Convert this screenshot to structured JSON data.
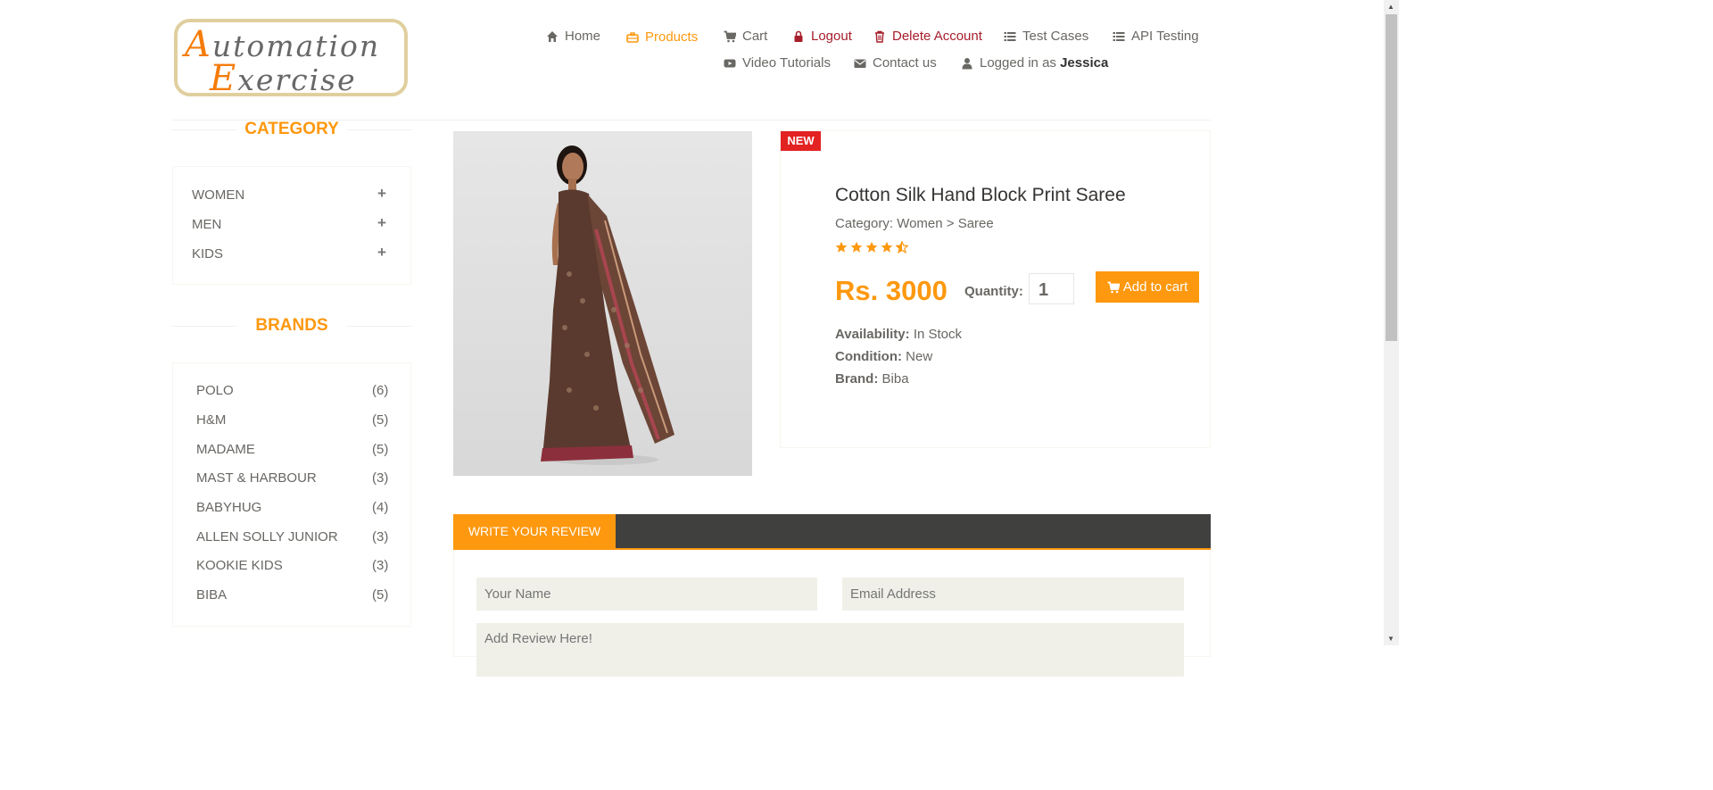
{
  "logo": {
    "line1_cap": "A",
    "line1_rest": "utomation",
    "line2_cap": "E",
    "line2_rest": "xercise"
  },
  "nav": {
    "home": "Home",
    "products": "Products",
    "cart": "Cart",
    "logout": "Logout",
    "delete_account": "Delete Account",
    "test_cases": "Test Cases",
    "api_testing": "API Testing",
    "video_tutorials": "Video Tutorials",
    "contact_us": "Contact us",
    "logged_in_prefix": "Logged in as",
    "logged_in_user": "Jessica"
  },
  "sidebar": {
    "category_title": "CATEGORY",
    "categories": [
      {
        "label": "WOMEN"
      },
      {
        "label": "MEN"
      },
      {
        "label": "KIDS"
      }
    ],
    "plus": "+",
    "brands_title": "BRANDS",
    "brands": [
      {
        "name": "POLO",
        "count": "(6)"
      },
      {
        "name": "H&M",
        "count": "(5)"
      },
      {
        "name": "MADAME",
        "count": "(5)"
      },
      {
        "name": "MAST & HARBOUR",
        "count": "(3)"
      },
      {
        "name": "BABYHUG",
        "count": "(4)"
      },
      {
        "name": "ALLEN SOLLY JUNIOR",
        "count": "(3)"
      },
      {
        "name": "KOOKIE KIDS",
        "count": "(3)"
      },
      {
        "name": "BIBA",
        "count": "(5)"
      }
    ]
  },
  "product": {
    "badge": "NEW",
    "title": "Cotton Silk Hand Block Print Saree",
    "category": "Category: Women > Saree",
    "rating": 4.5,
    "price": "Rs. 3000",
    "quantity_label": "Quantity:",
    "quantity_value": "1",
    "add_to_cart": "Add to cart",
    "availability_label": "Availability:",
    "availability": "In Stock",
    "condition_label": "Condition:",
    "condition": "New",
    "brand_label": "Brand:",
    "brand": "Biba"
  },
  "review": {
    "tab": "WRITE YOUR REVIEW",
    "name_placeholder": "Your Name",
    "email_placeholder": "Email Address",
    "review_placeholder": "Add Review Here!"
  },
  "colors": {
    "accent": "#FE980F",
    "dark_bar": "#40403e",
    "badge_red": "#e32222",
    "danger": "#a71d2a"
  }
}
